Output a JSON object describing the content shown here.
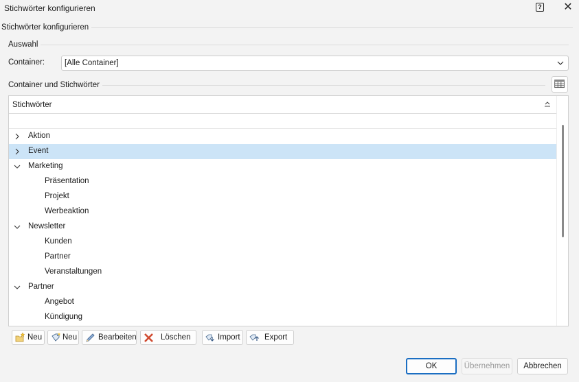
{
  "window": {
    "title": "Stichwörter konfigurieren",
    "help_glyph": "?",
    "close_glyph": "✕"
  },
  "group_main": {
    "label": "Stichwörter konfigurieren"
  },
  "group_selection": {
    "label": "Auswahl"
  },
  "container": {
    "label": "Container:",
    "value": "[Alle Container]"
  },
  "group_tree": {
    "label": "Container und Stichwörter"
  },
  "tree": {
    "column_header": "Stichwörter",
    "rows": [
      {
        "label": "Aktion",
        "level": 0,
        "expander": "collapsed",
        "selected": false
      },
      {
        "label": "Event",
        "level": 0,
        "expander": "collapsed",
        "selected": true
      },
      {
        "label": "Marketing",
        "level": 0,
        "expander": "expanded",
        "selected": false
      },
      {
        "label": "Präsentation",
        "level": 1,
        "expander": "none",
        "selected": false
      },
      {
        "label": "Projekt",
        "level": 1,
        "expander": "none",
        "selected": false
      },
      {
        "label": "Werbeaktion",
        "level": 1,
        "expander": "none",
        "selected": false
      },
      {
        "label": "Newsletter",
        "level": 0,
        "expander": "expanded",
        "selected": false
      },
      {
        "label": "Kunden",
        "level": 1,
        "expander": "none",
        "selected": false
      },
      {
        "label": "Partner",
        "level": 1,
        "expander": "none",
        "selected": false
      },
      {
        "label": "Veranstaltungen",
        "level": 1,
        "expander": "none",
        "selected": false
      },
      {
        "label": "Partner",
        "level": 0,
        "expander": "expanded",
        "selected": false
      },
      {
        "label": "Angebot",
        "level": 1,
        "expander": "none",
        "selected": false
      },
      {
        "label": "Kündigung",
        "level": 1,
        "expander": "none",
        "selected": false
      }
    ]
  },
  "toolbar": {
    "new_container": "Neu",
    "new_keyword": "Neu",
    "edit": "Bearbeiten",
    "delete": "Löschen",
    "import": "Import",
    "export": "Export"
  },
  "dialog": {
    "ok": "OK",
    "apply": "Übernehmen",
    "cancel": "Abbrechen"
  },
  "colors": {
    "selection": "#cce4f7",
    "accent": "#1b6ec2",
    "delete_red": "#d04a2f"
  }
}
